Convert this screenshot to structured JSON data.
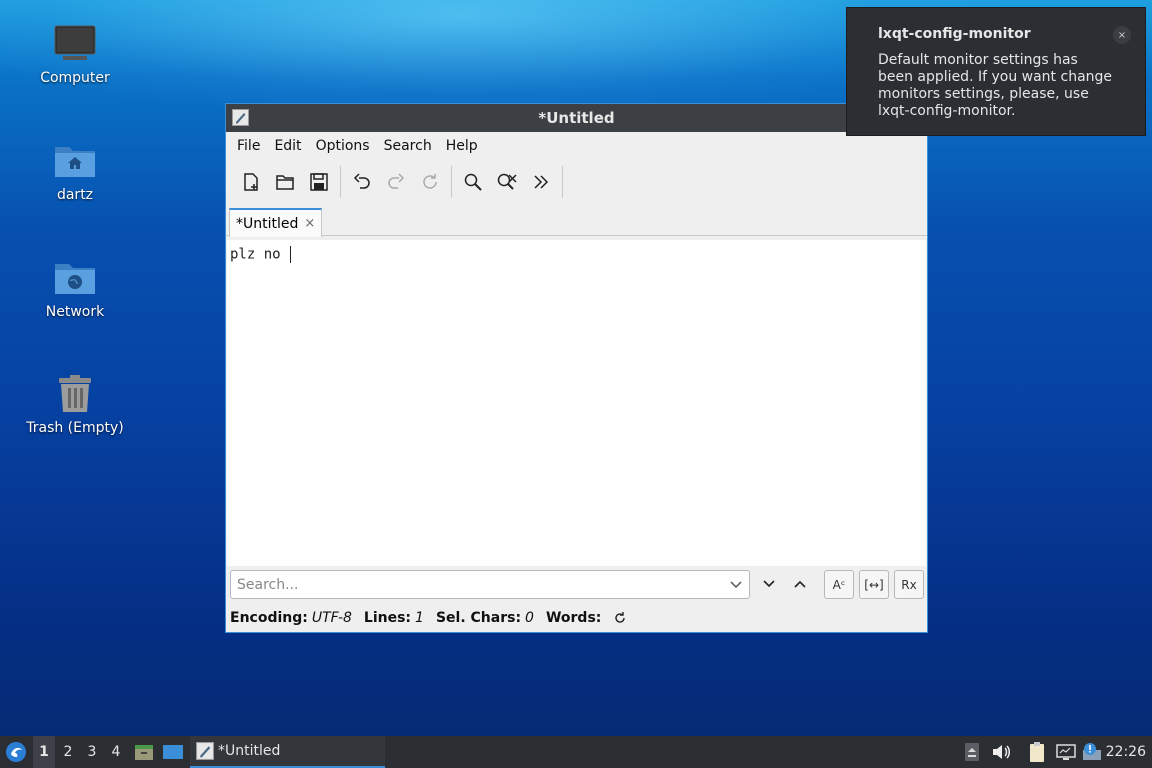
{
  "desktop": {
    "icons": [
      {
        "label": "Computer",
        "icon": "computer-icon"
      },
      {
        "label": "dartz",
        "icon": "home-folder-icon"
      },
      {
        "label": "Network",
        "icon": "network-folder-icon"
      },
      {
        "label": "Trash (Empty)",
        "icon": "trash-icon"
      }
    ]
  },
  "window": {
    "title": "*Untitled",
    "menu": [
      "File",
      "Edit",
      "Options",
      "Search",
      "Help"
    ],
    "toolbar_icons": [
      "new-document-icon",
      "open-folder-icon",
      "save-icon",
      "undo-icon",
      "redo-icon",
      "reload-icon",
      "find-icon",
      "find-replace-icon",
      "more-icon"
    ],
    "tab": {
      "label": "*Untitled",
      "close": "×"
    },
    "editor_text": "plz no ",
    "search": {
      "placeholder": "Search...",
      "toggles": {
        "match_case": "Aᶜ",
        "whole_word": "[↔]",
        "regex": "Rx"
      }
    },
    "status": {
      "encoding_label": "Encoding:",
      "encoding_value": "UTF-8",
      "lines_label": "Lines:",
      "lines_value": "1",
      "sel_label": "Sel. Chars:",
      "sel_value": "0",
      "words_label": "Words:"
    }
  },
  "notification": {
    "title": "lxqt-config-monitor",
    "body": "Default monitor settings has been applied. If you want change monitors settings, please, use lxqt-config-monitor.",
    "close": "×"
  },
  "taskbar": {
    "desktops": [
      "1",
      "2",
      "3",
      "4"
    ],
    "active_desktop": "1",
    "task_label": "*Untitled",
    "clock": "22:26"
  },
  "colors": {
    "accent": "#3a8fd8",
    "titlebar": "#3c3f44",
    "panel": "#2b2e33"
  }
}
